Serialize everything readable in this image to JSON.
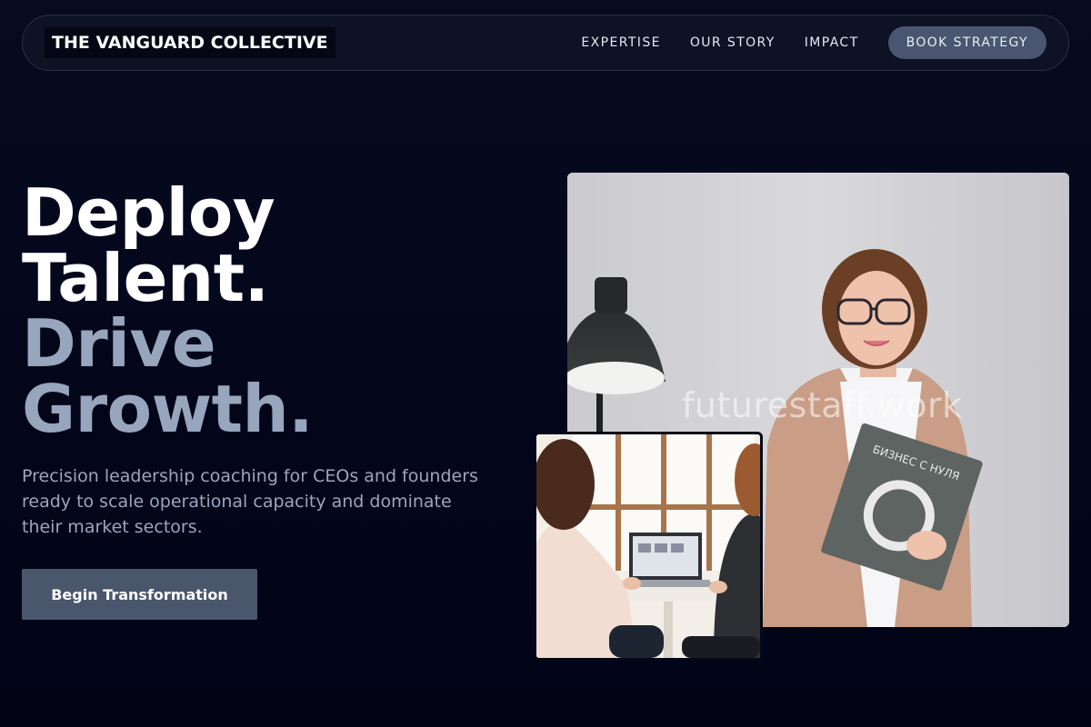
{
  "nav": {
    "logo": "THE VANGUARD COLLECTIVE",
    "links": [
      "EXPERTISE",
      "OUR STORY",
      "IMPACT"
    ],
    "cta": "BOOK STRATEGY"
  },
  "hero": {
    "headline": [
      "Deploy",
      "Talent.",
      "Drive",
      "Growth."
    ],
    "subtext": "Precision leadership coaching for CEOs and founders ready to scale operational capacity and dominate their market sectors.",
    "cta": "Begin Transformation"
  },
  "images": {
    "main_watermark": "futurestaff.work",
    "book_title": "БИЗНЕС С НУЛЯ"
  },
  "colors": {
    "background": "#03061a",
    "accent_button": "#4a566c",
    "headline_muted": "#97a5bd"
  }
}
